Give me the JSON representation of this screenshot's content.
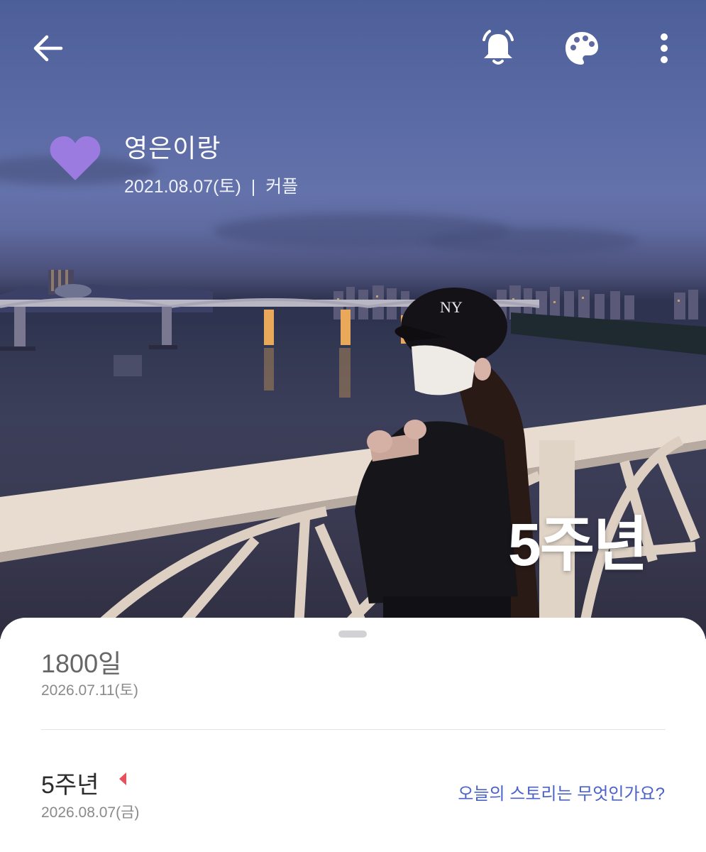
{
  "header": {
    "back_icon": "arrow-left-icon",
    "alarm_icon": "bell-icon",
    "theme_icon": "palette-icon",
    "menu_icon": "more-vertical-icon"
  },
  "couple": {
    "icon": "heart-icon",
    "icon_color": "#9b7be0",
    "name": "영은이랑",
    "start_date": "2021.08.07(토)",
    "separator": "|",
    "type": "커플"
  },
  "photo_overlay": {
    "title": "5주년"
  },
  "sheet": {
    "day_count_title": "1800일",
    "day_count_date": "2026.07.11(토)",
    "anniversary_title": "5주년",
    "anniversary_date": "2026.08.07(금)",
    "anniversary_marker_color": "#e8505b",
    "story_prompt": "오늘의 스토리는 무엇인가요?"
  },
  "colors": {
    "link": "#4b63c8",
    "sheet_bg": "#ffffff"
  }
}
